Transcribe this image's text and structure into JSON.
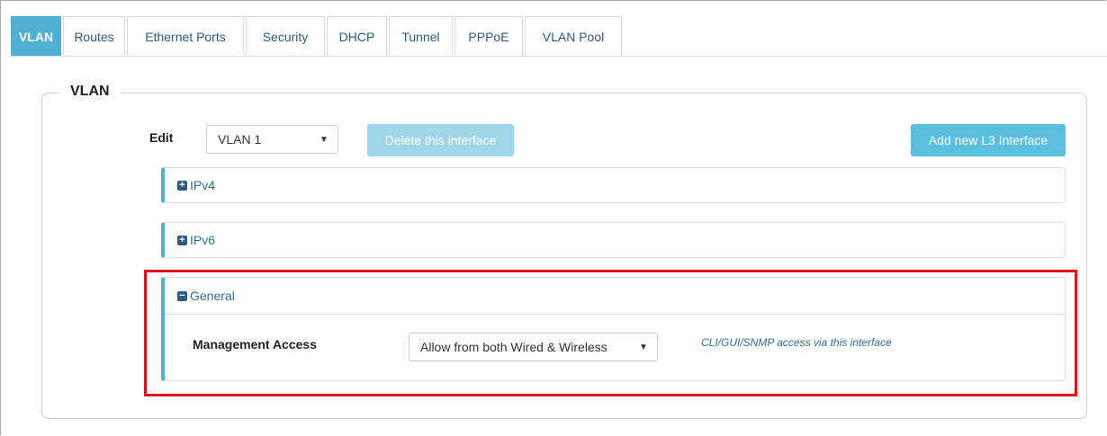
{
  "tabs": [
    {
      "label": "VLAN",
      "active": true
    },
    {
      "label": "Routes"
    },
    {
      "label": "Ethernet Ports"
    },
    {
      "label": "Security"
    },
    {
      "label": "DHCP"
    },
    {
      "label": "Tunnel"
    },
    {
      "label": "PPPoE"
    },
    {
      "label": "VLAN Pool"
    }
  ],
  "section": {
    "title": "VLAN"
  },
  "edit": {
    "label": "Edit",
    "selected": "VLAN 1"
  },
  "buttons": {
    "delete": "Delete this interface",
    "add": "Add new L3 Interface"
  },
  "panels": {
    "ipv4": {
      "title": "IPv4",
      "state": "collapsed"
    },
    "ipv6": {
      "title": "IPv6",
      "state": "collapsed"
    },
    "general": {
      "title": "General",
      "state": "expanded"
    }
  },
  "general": {
    "management_access": {
      "label": "Management Access",
      "selected": "Allow from both Wired & Wireless",
      "help": "CLI/GUI/SNMP access via this interface"
    }
  },
  "colors": {
    "accent": "#4fb0d4",
    "highlight": "#e0131c"
  }
}
